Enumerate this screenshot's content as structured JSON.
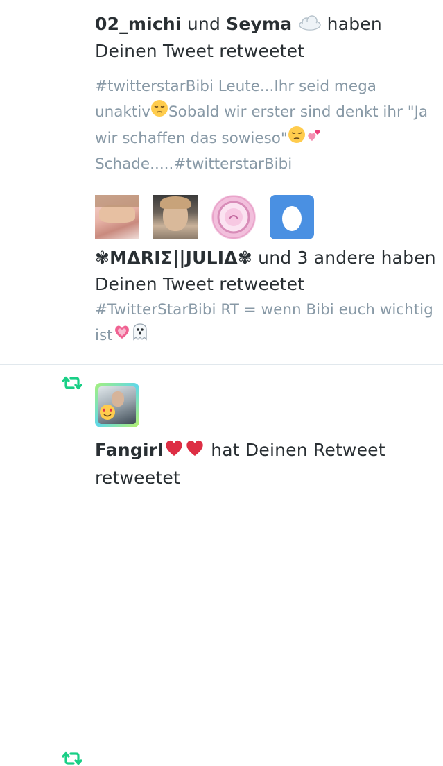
{
  "notifications": [
    {
      "actor1": "02_michi",
      "joiner": " und ",
      "actor2": "Seyma",
      "action": " haben Deinen Tweet retweetet",
      "tweet_part1": "#twitterstarBibi Leute...Ihr seid mega unaktiv",
      "tweet_part2": "Sobald wir erster sind denkt ihr \"Ja wir schaffen das sowieso\"",
      "tweet_part3": "Schade.....#twitterstarBibi"
    },
    {
      "actor": "✾ΜΔRIΣ||JULIΔ✾",
      "action": " und 3 andere haben Deinen Tweet retweetet",
      "tweet_text": "#TwitterStarBibi RT = wenn Bibi euch wichtig ist"
    },
    {
      "actor": "Fangirl",
      "action": " hat Deinen Retweet retweetet"
    }
  ],
  "icons": {
    "retweet": "retweet-icon",
    "cloud": "cloud-emoji",
    "pensive": "pensive-face-emoji",
    "two_hearts": "two-hearts-emoji",
    "growing_heart": "growing-heart-emoji",
    "ghost": "ghost-emoji",
    "red_heart": "red-heart-emoji"
  },
  "colors": {
    "retweet_green": "#19cf86",
    "primary_text": "#292f33",
    "secondary_text": "#8899a6",
    "divider": "#e1e8ed",
    "egg_bg": "#4a90e2"
  }
}
